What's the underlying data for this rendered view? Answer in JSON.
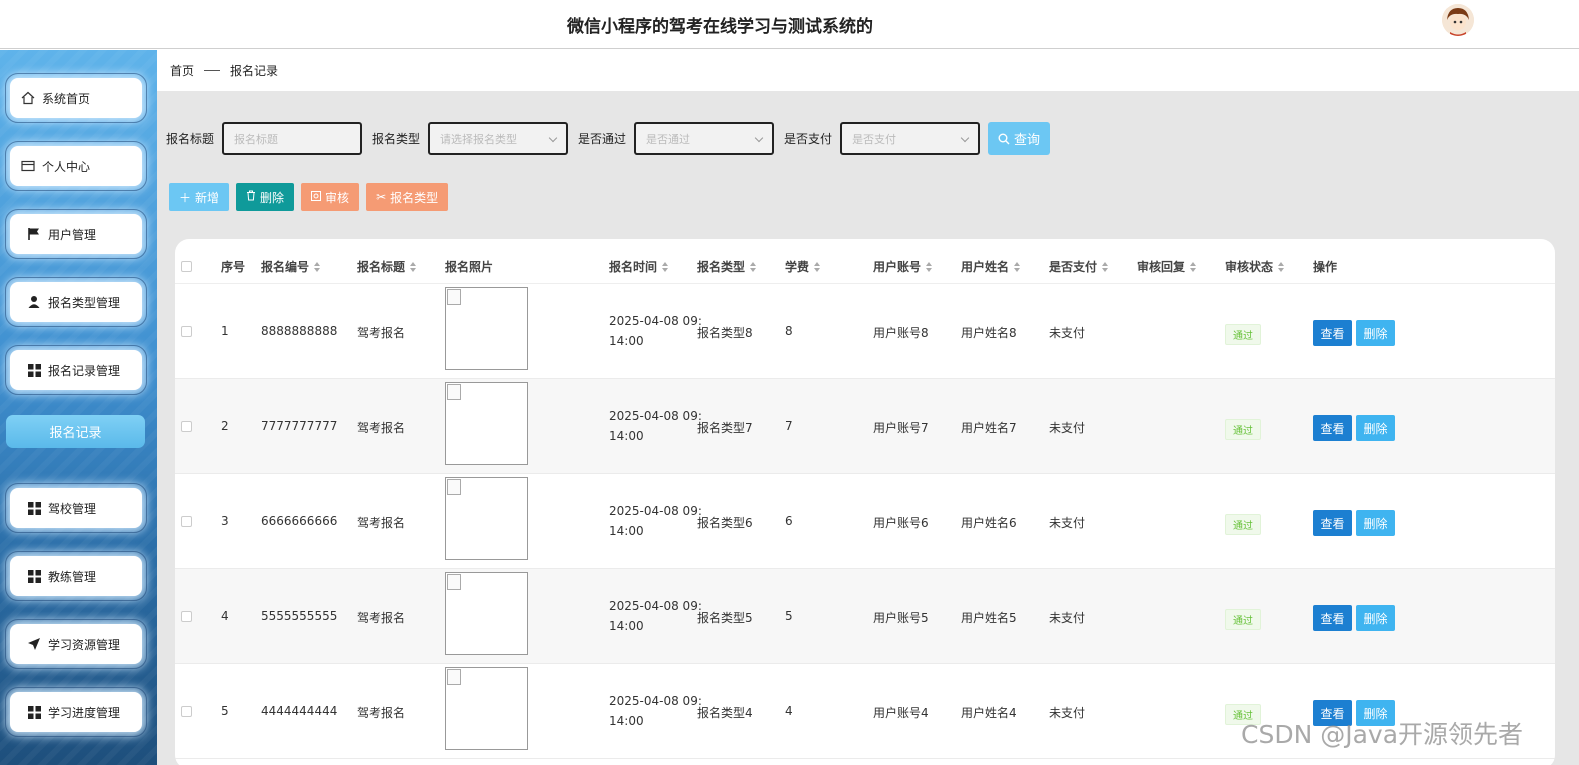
{
  "header": {
    "title": "微信小程序的驾考在线学习与测试系统的",
    "avatar_icon": "cartoon-avatar"
  },
  "sidebar": {
    "items": [
      {
        "label": "系统首页",
        "icon": "home-icon"
      },
      {
        "label": "个人中心",
        "icon": "card-icon"
      },
      {
        "label": "用户管理",
        "icon": "flag-icon"
      },
      {
        "label": "报名类型管理",
        "icon": "user-icon"
      },
      {
        "label": "报名记录管理",
        "icon": "grid-icon"
      },
      {
        "label": "驾校管理",
        "icon": "grid-icon"
      },
      {
        "label": "教练管理",
        "icon": "grid-icon"
      },
      {
        "label": "学习资源管理",
        "icon": "send-icon"
      },
      {
        "label": "学习进度管理",
        "icon": "grid-icon"
      }
    ],
    "active_sub": "报名记录"
  },
  "breadcrumb": {
    "home": "首页",
    "current": "报名记录"
  },
  "search": {
    "title_label": "报名标题",
    "title_placeholder": "报名标题",
    "type_label": "报名类型",
    "type_placeholder": "请选择报名类型",
    "pass_label": "是否通过",
    "pass_placeholder": "是否通过",
    "pay_label": "是否支付",
    "pay_placeholder": "是否支付",
    "query_label": "查询"
  },
  "actions": {
    "add": "新增",
    "delete": "删除",
    "review": "审核",
    "type": "报名类型"
  },
  "colors": {
    "accent": "#6cc7f3",
    "delete_teal": "#0f9a9a",
    "orange": "#f59b74",
    "view_blue": "#1c7fd1"
  },
  "table": {
    "headers": {
      "index": "序号",
      "code": "报名编号",
      "title": "报名标题",
      "photo": "报名照片",
      "time": "报名时间",
      "type": "报名类型",
      "fee": "学费",
      "account": "用户账号",
      "name": "用户姓名",
      "paid": "是否支付",
      "reply": "审核回复",
      "status": "审核状态",
      "ops": "操作"
    },
    "rows": [
      {
        "index": "1",
        "code": "8888888888",
        "title": "驾考报名",
        "time1": "2025-04-08 09:",
        "time2": "14:00",
        "type": "报名类型8",
        "fee": "8",
        "account": "用户账号8",
        "name": "用户姓名8",
        "paid": "未支付",
        "status": "通过",
        "view": "查看",
        "del": "删除"
      },
      {
        "index": "2",
        "code": "7777777777",
        "title": "驾考报名",
        "time1": "2025-04-08 09:",
        "time2": "14:00",
        "type": "报名类型7",
        "fee": "7",
        "account": "用户账号7",
        "name": "用户姓名7",
        "paid": "未支付",
        "status": "通过",
        "view": "查看",
        "del": "删除"
      },
      {
        "index": "3",
        "code": "6666666666",
        "title": "驾考报名",
        "time1": "2025-04-08 09:",
        "time2": "14:00",
        "type": "报名类型6",
        "fee": "6",
        "account": "用户账号6",
        "name": "用户姓名6",
        "paid": "未支付",
        "status": "通过",
        "view": "查看",
        "del": "删除"
      },
      {
        "index": "4",
        "code": "5555555555",
        "title": "驾考报名",
        "time1": "2025-04-08 09:",
        "time2": "14:00",
        "type": "报名类型5",
        "fee": "5",
        "account": "用户账号5",
        "name": "用户姓名5",
        "paid": "未支付",
        "status": "通过",
        "view": "查看",
        "del": "删除"
      },
      {
        "index": "5",
        "code": "4444444444",
        "title": "驾考报名",
        "time1": "2025-04-08 09:",
        "time2": "14:00",
        "type": "报名类型4",
        "fee": "4",
        "account": "用户账号4",
        "name": "用户姓名4",
        "paid": "未支付",
        "status": "通过",
        "view": "查看",
        "del": "删除"
      }
    ]
  },
  "watermark": "CSDN @Java开源领先者"
}
